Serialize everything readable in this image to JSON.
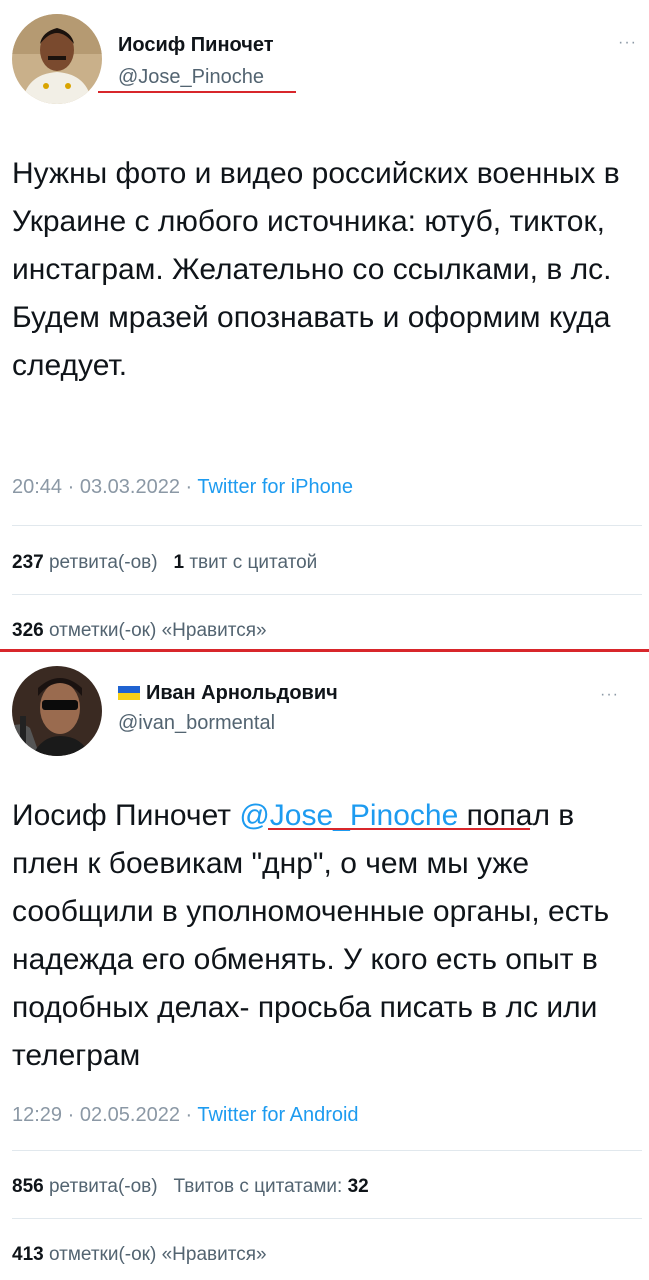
{
  "tweets": [
    {
      "author_name": "Иосиф Пиночет",
      "author_handle": "@Jose_Pinoche",
      "more_icon": "more-icon",
      "body": "Нужны фото и видео российских военных в Украине с любого источника: ютуб, тикток, инстаграм. Желательно со ссылками, в лс. Будем мразей опознавать и оформим куда следует.",
      "time": "20:44",
      "date": "03.03.2022",
      "source": "Twitter for iPhone",
      "retweets_count": "237",
      "retweets_label": "ретвита(-ов)",
      "quotes_count": "1",
      "quotes_label": "твит с цитатой",
      "likes_count": "326",
      "likes_label": "отметки(-ок) «Нравится»"
    },
    {
      "author_name": "Иван Арнольдович",
      "author_handle": "@ivan_bormental",
      "flag_icon": "ukraine-flag-icon",
      "body_prefix": "Иосиф Пиночет ",
      "body_mention": "@Jose_Pinoche",
      "body_suffix": " попал в плен к боевикам \"днр\", о чем мы уже сообщили в уполномоченные органы, есть надежда его обменять. У кого есть опыт в подобных делах- просьба писать в лс или телеграм",
      "time": "12:29",
      "date": "02.05.2022",
      "source": "Twitter for Android",
      "retweets_count": "856",
      "retweets_label": "ретвита(-ов)",
      "quotes_label": "Твитов с цитатами:",
      "quotes_count": "32",
      "likes_count": "413",
      "likes_label": "отметки(-ок) «Нравится»"
    }
  ],
  "separator": " · ",
  "colors": {
    "accent": "#1d9bf0",
    "highlight": "#d8262b"
  }
}
